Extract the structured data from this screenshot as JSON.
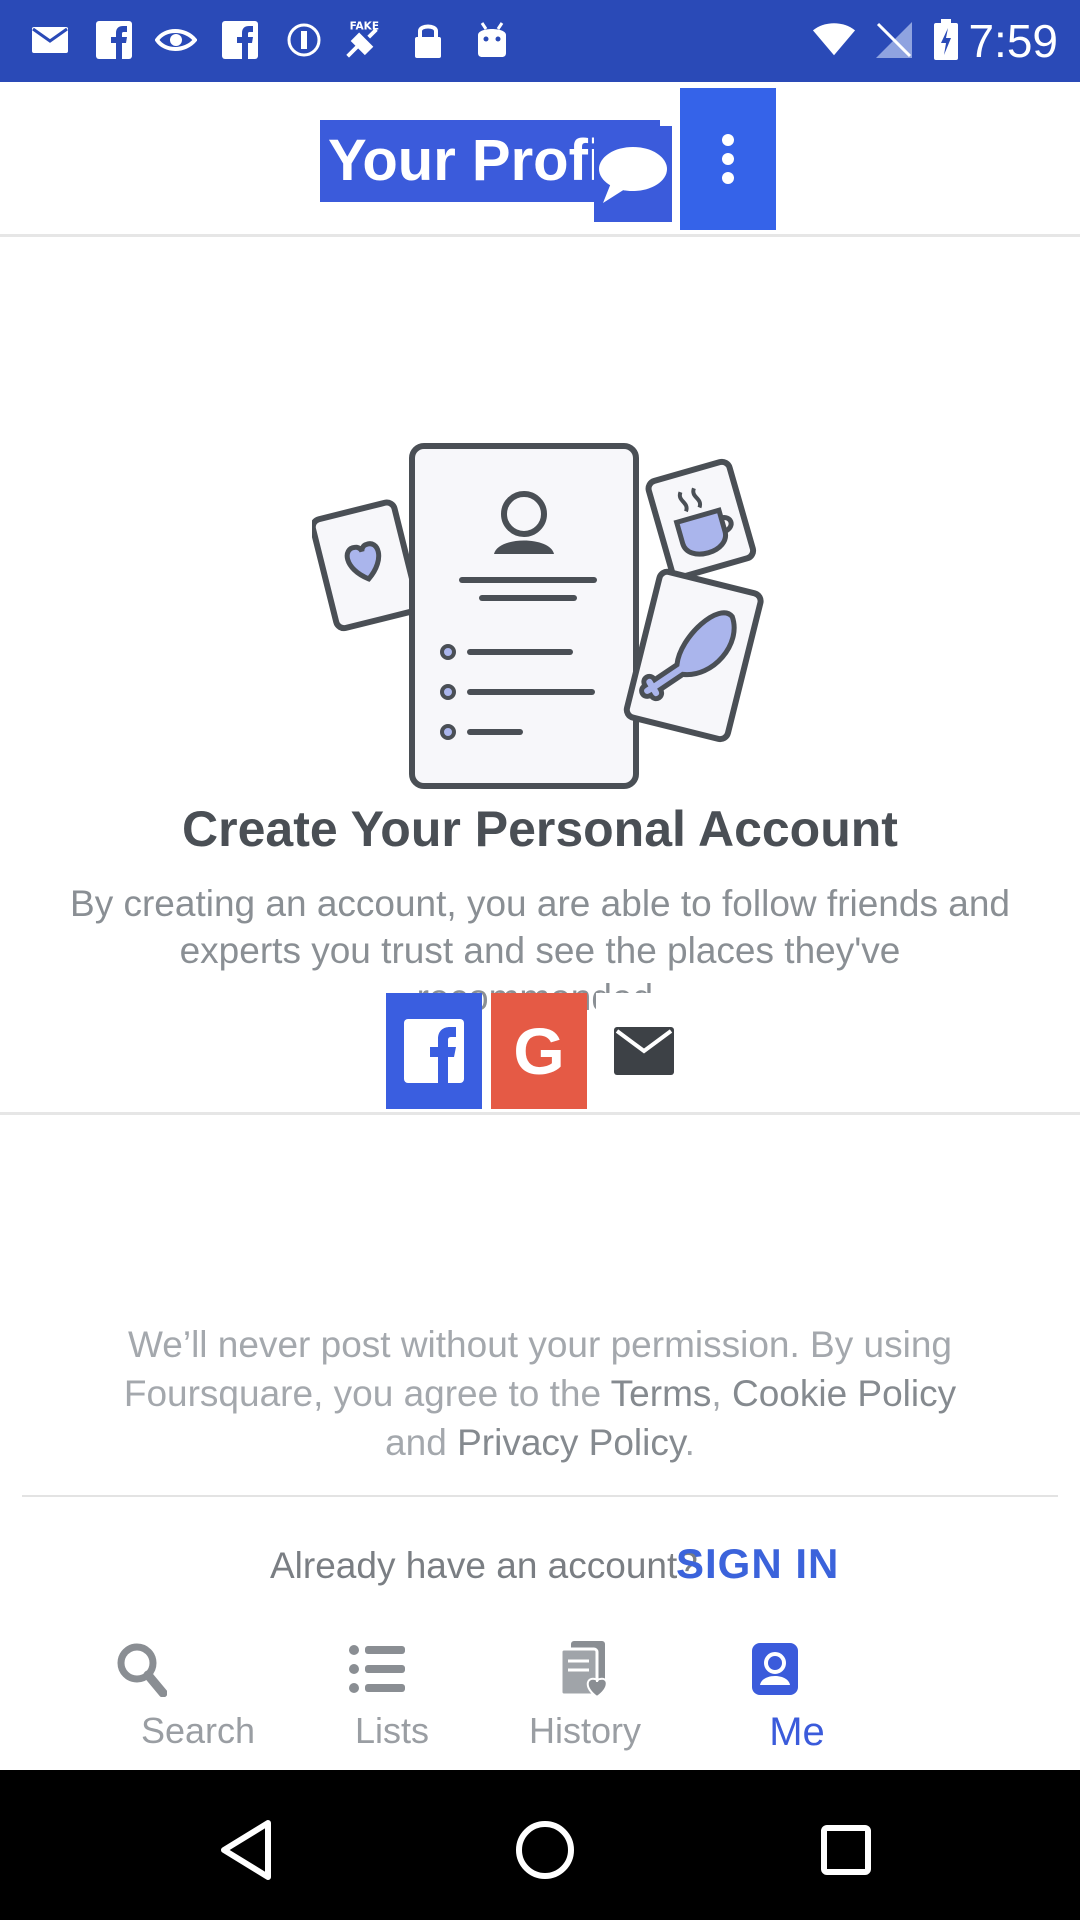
{
  "status_bar": {
    "time": "7:59",
    "left_icons": [
      "mail-icon",
      "facebook-icon",
      "nvidia-icon",
      "facebook-icon",
      "info-icon",
      "fake-gps-icon",
      "lock-icon",
      "android-icon"
    ],
    "right_icons": [
      "wifi-icon",
      "no-signal-icon",
      "battery-icon"
    ]
  },
  "header": {
    "title": "Your Profile"
  },
  "main": {
    "headline": "Create Your Personal Account",
    "description": "By creating an account, you are able to follow friends and experts you trust and see the places they've recommended.",
    "social_buttons": [
      "facebook",
      "google",
      "email"
    ],
    "google_letter": "G",
    "legal": {
      "part1": "We’ll never post without your permission. By using Foursquare, you agree to the ",
      "terms": "Terms",
      "comma": ", ",
      "cookie": "Cookie Policy",
      "and": " and ",
      "privacy": "Privacy Policy",
      "period": "."
    },
    "already_text": "Already have an account?",
    "signin_label": "SIGN IN"
  },
  "tabs": [
    {
      "label": "Search",
      "icon": "search-icon"
    },
    {
      "label": "Lists",
      "icon": "list-icon"
    },
    {
      "label": "History",
      "icon": "history-icon"
    },
    {
      "label": "Me",
      "icon": "profile-icon",
      "active": true
    }
  ],
  "colors": {
    "status_bar": "#2a4ab7",
    "accent": "#3b5bdb",
    "facebook": "#3a5ee0",
    "google": "#e55a45"
  }
}
